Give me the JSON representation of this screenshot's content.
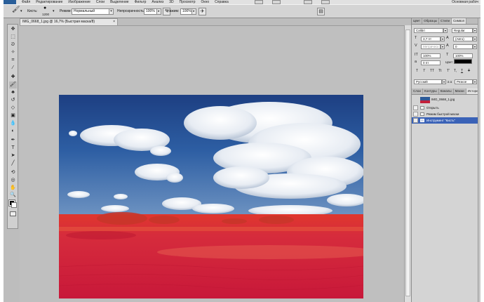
{
  "menubar": {
    "items": [
      "Файл",
      "Редактирование",
      "Изображение",
      "Слои",
      "Выделение",
      "Фильтр",
      "Анализ",
      "3D",
      "Просмотр",
      "Окно",
      "Справка"
    ],
    "workspace": "Основная рабоч"
  },
  "options": {
    "brush_label": "Кисть:",
    "brush_size": "1200",
    "mode_label": "Режим:",
    "mode_value": "Нормальный",
    "opacity_label": "Непрозрачность:",
    "opacity_value": "100%",
    "flow_label": "Нажим:",
    "flow_value": "100%"
  },
  "document": {
    "tab_title": "IMG_0668_1.jpg @ 16,7% (Быстрая маска/8)",
    "close": "×"
  },
  "character_panel": {
    "tabs": [
      "Цвет",
      "Образцы",
      "Стили",
      "Символ"
    ],
    "active_tab": "Символ",
    "font_family": "Calibri",
    "font_style": "Regular",
    "font_size": "3,7 пт",
    "leading": "(Авто)",
    "kerning": "Метрическ",
    "tracking": "0",
    "vscale": "100%",
    "hscale": "100%",
    "baseline": "0 пт",
    "color_label": "Цвет:",
    "format_buttons": [
      "T",
      "T",
      "TT",
      "Tt",
      "T'",
      "T,",
      "T",
      "T"
    ],
    "language": "Русский",
    "antialias": "Резкое",
    "aa_prefix": "a a",
    "swatch_color": "#000000"
  },
  "history_panel": {
    "tabs": [
      "Слои",
      "Контуры",
      "Каналы",
      "Маски",
      "История"
    ],
    "active_tab": "История",
    "snapshot": "IMG_0668_1.jpg",
    "items": [
      "Открыть",
      "Режим быстрой маски",
      "Инструмент \"Кисть\""
    ],
    "selected_index": 2
  },
  "colors": {
    "foreground": "#000000",
    "background": "#ffffff",
    "selection": "#3a62b7",
    "quick_mask_overlay": "#d11a35"
  },
  "icons": [
    "move-tool-icon",
    "marquee-tool-icon",
    "lasso-tool-icon",
    "quick-select-icon",
    "crop-tool-icon",
    "eyedropper-icon",
    "healing-brush-icon",
    "brush-tool-icon",
    "clone-stamp-icon",
    "history-brush-icon",
    "eraser-icon",
    "gradient-icon",
    "blur-icon",
    "dodge-icon",
    "pen-tool-icon",
    "type-tool-icon",
    "path-select-icon",
    "shape-tool-icon",
    "3d-rotate-icon",
    "3d-camera-icon",
    "hand-tool-icon",
    "zoom-tool-icon"
  ]
}
